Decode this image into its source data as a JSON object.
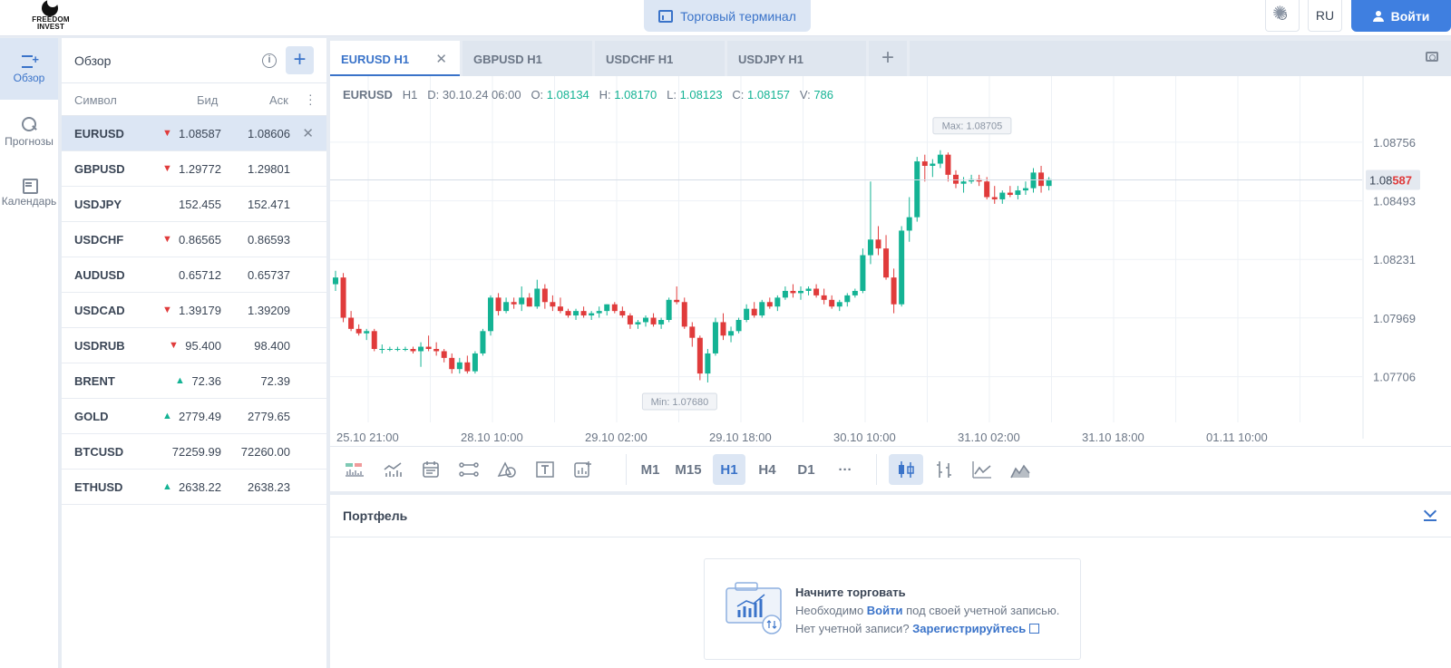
{
  "header": {
    "logo_text": "FREEDOM INVEST",
    "terminal_label": "Торговый терминал",
    "lang": "RU",
    "login_label": "Войти",
    "theme_icon": "sun-icon"
  },
  "leftnav": {
    "items": [
      {
        "label": "Обзор",
        "icon": "watchlist-icon",
        "active": true
      },
      {
        "label": "Прогнозы",
        "icon": "forecast-icon",
        "active": false
      },
      {
        "label": "Календарь",
        "icon": "calendar-icon",
        "active": false
      }
    ]
  },
  "watchlist": {
    "title": "Обзор",
    "columns": {
      "symbol": "Символ",
      "bid": "Бид",
      "ask": "Аск"
    },
    "rows": [
      {
        "symbol": "EURUSD",
        "dir": "down",
        "bid": "1.08587",
        "ask": "1.08606"
      },
      {
        "symbol": "GBPUSD",
        "dir": "down",
        "bid": "1.29772",
        "ask": "1.29801"
      },
      {
        "symbol": "USDJPY",
        "dir": "",
        "bid": "152.455",
        "ask": "152.471"
      },
      {
        "symbol": "USDCHF",
        "dir": "down",
        "bid": "0.86565",
        "ask": "0.86593"
      },
      {
        "symbol": "AUDUSD",
        "dir": "",
        "bid": "0.65712",
        "ask": "0.65737"
      },
      {
        "symbol": "USDCAD",
        "dir": "down",
        "bid": "1.39179",
        "ask": "1.39209"
      },
      {
        "symbol": "USDRUB",
        "dir": "down",
        "bid": "95.400",
        "ask": "98.400"
      },
      {
        "symbol": "BRENT",
        "dir": "up",
        "bid": "72.36",
        "ask": "72.39"
      },
      {
        "symbol": "GOLD",
        "dir": "up",
        "bid": "2779.49",
        "ask": "2779.65"
      },
      {
        "symbol": "BTCUSD",
        "dir": "",
        "bid": "72259.99",
        "ask": "72260.00"
      },
      {
        "symbol": "ETHUSD",
        "dir": "up",
        "bid": "2638.22",
        "ask": "2638.23"
      }
    ]
  },
  "tabs": [
    {
      "label": "EURUSD H1",
      "active": true
    },
    {
      "label": "GBPUSD H1",
      "active": false
    },
    {
      "label": "USDCHF H1",
      "active": false
    },
    {
      "label": "USDJPY H1",
      "active": false
    }
  ],
  "ohlc": {
    "symbol": "EURUSD",
    "tf": "H1",
    "d_label": "D:",
    "date": "30.10.24 06:00",
    "o_label": "O:",
    "o": "1.08134",
    "h_label": "H:",
    "h": "1.08170",
    "l_label": "L:",
    "l": "1.08123",
    "c_label": "C:",
    "c": "1.08157",
    "v_label": "V:",
    "v": "786"
  },
  "timeframes": [
    "M1",
    "M15",
    "H1",
    "H4",
    "D1",
    "···"
  ],
  "active_timeframe": "H1",
  "colors": {
    "up": "#14b394",
    "down": "#e03b3b",
    "accent": "#3a73c9",
    "accent_bg": "#dce6f4"
  },
  "chart_data": {
    "type": "candlestick",
    "symbol": "EURUSD",
    "timeframe": "H1",
    "price_ticks": [
      1.08756,
      1.08493,
      1.08231,
      1.07969,
      1.07706
    ],
    "ylim": [
      1.0755,
      1.0893
    ],
    "time_ticks": [
      "25.10 21:00",
      "28.10 10:00",
      "29.10 02:00",
      "29.10 18:00",
      "30.10 10:00",
      "31.10 02:00",
      "31.10 18:00",
      "01.11 10:00"
    ],
    "current_price": "1.08587",
    "current_price_prefix": "1.08",
    "current_price_suffix": "587",
    "max_label": "Max: 1.08705",
    "min_label": "Min: 1.07680",
    "candles": [
      [
        1.0812,
        1.0818,
        1.0809,
        1.0815
      ],
      [
        1.0815,
        1.0817,
        1.0795,
        1.0797
      ],
      [
        1.0797,
        1.08,
        1.0791,
        1.0792
      ],
      [
        1.0792,
        1.0794,
        1.0789,
        1.079
      ],
      [
        1.079,
        1.0792,
        1.0787,
        1.0791
      ],
      [
        1.0791,
        1.0792,
        1.0782,
        1.0783
      ],
      [
        1.0783,
        1.0785,
        1.0781,
        1.0783
      ],
      [
        1.0783,
        1.0784,
        1.0782,
        1.0783
      ],
      [
        1.0783,
        1.0784,
        1.0782,
        1.0783
      ],
      [
        1.0783,
        1.0784,
        1.0782,
        1.0783
      ],
      [
        1.0783,
        1.0784,
        1.0781,
        1.0782
      ],
      [
        1.0782,
        1.0786,
        1.0775,
        1.0784
      ],
      [
        1.0784,
        1.0789,
        1.0782,
        1.0783
      ],
      [
        1.0783,
        1.0786,
        1.078,
        1.0782
      ],
      [
        1.0782,
        1.0783,
        1.0777,
        1.0779
      ],
      [
        1.0779,
        1.0781,
        1.0772,
        1.0774
      ],
      [
        1.0774,
        1.0779,
        1.0772,
        1.0777
      ],
      [
        1.0777,
        1.078,
        1.0772,
        1.0773
      ],
      [
        1.0773,
        1.0782,
        1.0772,
        1.0781
      ],
      [
        1.0781,
        1.0792,
        1.078,
        1.0791
      ],
      [
        1.0791,
        1.0807,
        1.0789,
        1.0806
      ],
      [
        1.0806,
        1.0808,
        1.0798,
        1.08
      ],
      [
        1.08,
        1.0806,
        1.0799,
        1.0804
      ],
      [
        1.0804,
        1.0806,
        1.0801,
        1.0803
      ],
      [
        1.0803,
        1.0811,
        1.08,
        1.0806
      ],
      [
        1.0806,
        1.0808,
        1.0802,
        1.0802
      ],
      [
        1.0802,
        1.0814,
        1.0801,
        1.081
      ],
      [
        1.081,
        1.0812,
        1.0801,
        1.0804
      ],
      [
        1.0804,
        1.0807,
        1.08,
        1.0802
      ],
      [
        1.0802,
        1.0806,
        1.0799,
        1.08
      ],
      [
        1.08,
        1.0801,
        1.0797,
        1.0798
      ],
      [
        1.0798,
        1.0801,
        1.0796,
        1.08
      ],
      [
        1.08,
        1.0802,
        1.0797,
        1.0798
      ],
      [
        1.0798,
        1.08,
        1.0796,
        1.0799
      ],
      [
        1.0799,
        1.0802,
        1.0797,
        1.08
      ],
      [
        1.08,
        1.0803,
        1.0798,
        1.0803
      ],
      [
        1.0803,
        1.0804,
        1.0799,
        1.08
      ],
      [
        1.08,
        1.0802,
        1.0797,
        1.0798
      ],
      [
        1.0798,
        1.0799,
        1.0792,
        1.0794
      ],
      [
        1.0794,
        1.0796,
        1.0792,
        1.0795
      ],
      [
        1.0795,
        1.0798,
        1.0793,
        1.0797
      ],
      [
        1.0797,
        1.0799,
        1.0793,
        1.0794
      ],
      [
        1.0794,
        1.0797,
        1.0792,
        1.0796
      ],
      [
        1.0796,
        1.0806,
        1.0795,
        1.0805
      ],
      [
        1.0805,
        1.0811,
        1.0803,
        1.0804
      ],
      [
        1.0804,
        1.0806,
        1.0792,
        1.0793
      ],
      [
        1.0793,
        1.0795,
        1.0784,
        1.0788
      ],
      [
        1.0788,
        1.0789,
        1.0769,
        1.0772
      ],
      [
        1.0772,
        1.0783,
        1.0768,
        1.0781
      ],
      [
        1.0781,
        1.0797,
        1.078,
        1.0795
      ],
      [
        1.0795,
        1.0799,
        1.0787,
        1.0789
      ],
      [
        1.0789,
        1.0793,
        1.0786,
        1.0791
      ],
      [
        1.0791,
        1.0797,
        1.079,
        1.0796
      ],
      [
        1.0796,
        1.0803,
        1.0795,
        1.0801
      ],
      [
        1.0801,
        1.0804,
        1.0797,
        1.0798
      ],
      [
        1.0798,
        1.0805,
        1.0797,
        1.0804
      ],
      [
        1.0804,
        1.0806,
        1.0801,
        1.0802
      ],
      [
        1.0802,
        1.0807,
        1.08,
        1.0806
      ],
      [
        1.0806,
        1.0811,
        1.0805,
        1.0809
      ],
      [
        1.0809,
        1.0812,
        1.0806,
        1.0808
      ],
      [
        1.0808,
        1.0811,
        1.0805,
        1.0809
      ],
      [
        1.0809,
        1.0811,
        1.0807,
        1.081
      ],
      [
        1.081,
        1.0812,
        1.0806,
        1.0807
      ],
      [
        1.0807,
        1.081,
        1.0803,
        1.0805
      ],
      [
        1.0805,
        1.0807,
        1.0801,
        1.0802
      ],
      [
        1.0802,
        1.0805,
        1.08,
        1.0804
      ],
      [
        1.0804,
        1.0808,
        1.0802,
        1.0807
      ],
      [
        1.0807,
        1.081,
        1.0806,
        1.0809
      ],
      [
        1.0809,
        1.0828,
        1.0808,
        1.0825
      ],
      [
        1.0825,
        1.0858,
        1.0821,
        1.0832
      ],
      [
        1.0832,
        1.0838,
        1.0825,
        1.0828
      ],
      [
        1.0828,
        1.0834,
        1.0814,
        1.0815
      ],
      [
        1.0815,
        1.0819,
        1.0799,
        1.0803
      ],
      [
        1.0803,
        1.0838,
        1.0802,
        1.0836
      ],
      [
        1.0836,
        1.0851,
        1.0831,
        1.0842
      ],
      [
        1.0842,
        1.0869,
        1.084,
        1.0867
      ],
      [
        1.0867,
        1.087,
        1.0858,
        1.0865
      ],
      [
        1.0865,
        1.0868,
        1.086,
        1.0866
      ],
      [
        1.0866,
        1.0872,
        1.0864,
        1.087
      ],
      [
        1.087,
        1.0871,
        1.0858,
        1.0861
      ],
      [
        1.0861,
        1.0863,
        1.0855,
        1.0857
      ],
      [
        1.0857,
        1.086,
        1.0853,
        1.0858
      ],
      [
        1.0858,
        1.0861,
        1.0857,
        1.0859
      ],
      [
        1.0859,
        1.0861,
        1.0856,
        1.0858
      ],
      [
        1.0858,
        1.086,
        1.085,
        1.0851
      ],
      [
        1.0851,
        1.0856,
        1.0848,
        1.085
      ],
      [
        1.085,
        1.0854,
        1.0848,
        1.0853
      ],
      [
        1.0853,
        1.0856,
        1.0851,
        1.0852
      ],
      [
        1.0852,
        1.0856,
        1.085,
        1.0854
      ],
      [
        1.0854,
        1.0858,
        1.0852,
        1.0855
      ],
      [
        1.0855,
        1.0864,
        1.0853,
        1.0862
      ],
      [
        1.0862,
        1.0865,
        1.0853,
        1.0856
      ],
      [
        1.0856,
        1.086,
        1.0854,
        1.0859
      ]
    ]
  },
  "portfolio": {
    "title": "Портфель",
    "card_title": "Начните торговать",
    "line1_pre": "Необходимо ",
    "line1_link": "Войти",
    "line1_post": " под своей учетной записью.",
    "line2_pre": "Нет учетной записи? ",
    "line2_link": "Зарегистрируйтесь"
  }
}
